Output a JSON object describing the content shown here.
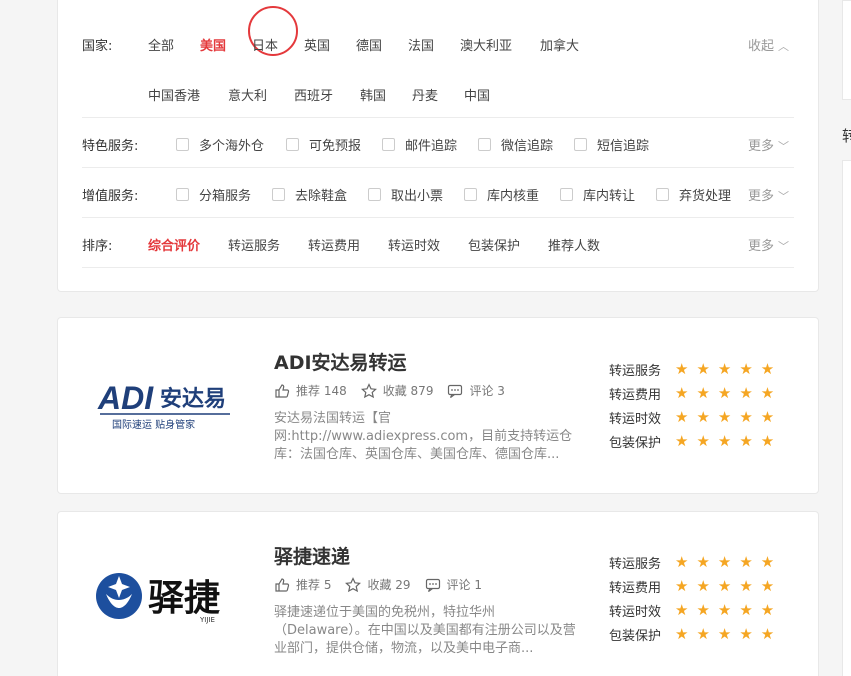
{
  "filters": {
    "country": {
      "label": "国家:",
      "row1": [
        "全部",
        "美国",
        "日本",
        "英国",
        "德国",
        "法国",
        "澳大利亚",
        "加拿大"
      ],
      "row2": [
        "中国香港",
        "意大利",
        "西班牙",
        "韩国",
        "丹麦",
        "中国"
      ],
      "selected": "美国",
      "collapse_label": "收起"
    },
    "features": {
      "label": "特色服务:",
      "options": [
        "多个海外仓",
        "可免预报",
        "邮件追踪",
        "微信追踪",
        "短信追踪"
      ],
      "more_label": "更多"
    },
    "value_added": {
      "label": "增值服务:",
      "options": [
        "分箱服务",
        "去除鞋盒",
        "取出小票",
        "库内核重",
        "库内转让",
        "弃货处理"
      ],
      "more_label": "更多"
    },
    "sort": {
      "label": "排序:",
      "options": [
        "综合评价",
        "转运服务",
        "转运费用",
        "转运时效",
        "包装保护",
        "推荐人数"
      ],
      "selected": "综合评价",
      "more_label": "更多"
    }
  },
  "side": {
    "char": "转"
  },
  "listings": [
    {
      "title": "ADI安达易转运",
      "logo": {
        "mark": "ADI",
        "brand": "安达易",
        "slogan": "国际速运   贴身管家"
      },
      "recommend": "推荐 148",
      "favorite": "收藏 879",
      "comment": "评论 3",
      "desc": "安达易法国转运【官网:http://www.adiexpress.com，目前支持转运仓库：法国仓库、英国仓库、美国仓库、德国仓库...",
      "ratings": [
        {
          "label": "转运服务",
          "stars": 5
        },
        {
          "label": "转运费用",
          "stars": 5
        },
        {
          "label": "转运时效",
          "stars": 5
        },
        {
          "label": "包装保护",
          "stars": 5
        }
      ]
    },
    {
      "title": "驿捷速递",
      "logo": {
        "brand": "驿捷",
        "sub": "YIJIE"
      },
      "recommend": "推荐 5",
      "favorite": "收藏 29",
      "comment": "评论 1",
      "desc": "驿捷速递位于美国的免税州，特拉华州（Delaware）。在中国以及美国都有注册公司以及营业部门，提供仓储，物流，以及美中电子商...",
      "ratings": [
        {
          "label": "转运服务",
          "stars": 5
        },
        {
          "label": "转运费用",
          "stars": 5
        },
        {
          "label": "转运时效",
          "stars": 5
        },
        {
          "label": "包装保护",
          "stars": 5
        }
      ]
    }
  ],
  "colors": {
    "accent": "#e4393c",
    "star": "#f5a623",
    "adi_blue": "#1f3f7a",
    "yijie_blue": "#1d4f9e"
  }
}
